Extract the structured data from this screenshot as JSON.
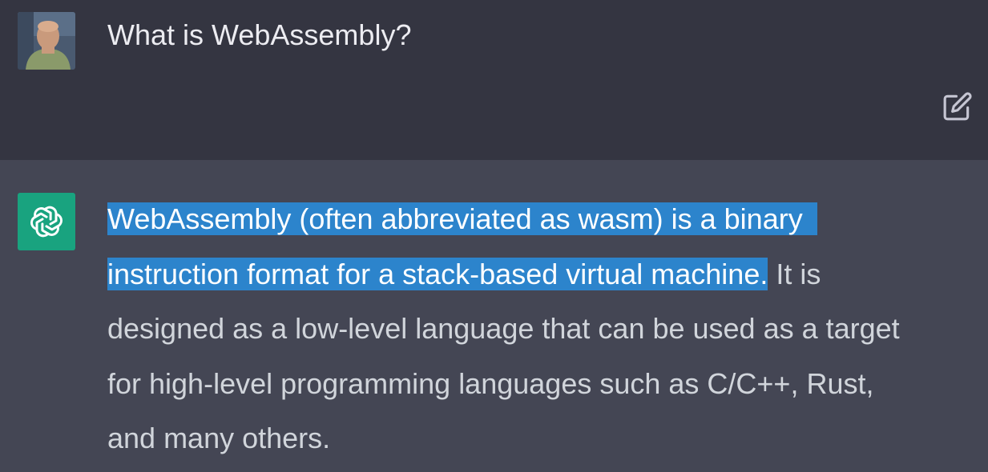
{
  "user_message": {
    "text": "What is WebAssembly?"
  },
  "assistant_message": {
    "highlighted_line1": "WebAssembly (often abbreviated as wasm) is a binary",
    "highlighted_line2": "instruction format for a stack-based virtual machine.",
    "rest_line2": " It is",
    "line3": "designed as a low-level language that can be used as a target",
    "line4": "for high-level programming languages such as C/C++, Rust,",
    "line5": "and many others."
  },
  "colors": {
    "user_bg": "#343541",
    "assistant_bg": "#444654",
    "selection": "#2c84cc",
    "gpt_avatar": "#19a37f"
  },
  "icons": {
    "edit": "edit-icon",
    "assistant_logo": "openai-logo-icon",
    "user_avatar": "user-avatar"
  }
}
